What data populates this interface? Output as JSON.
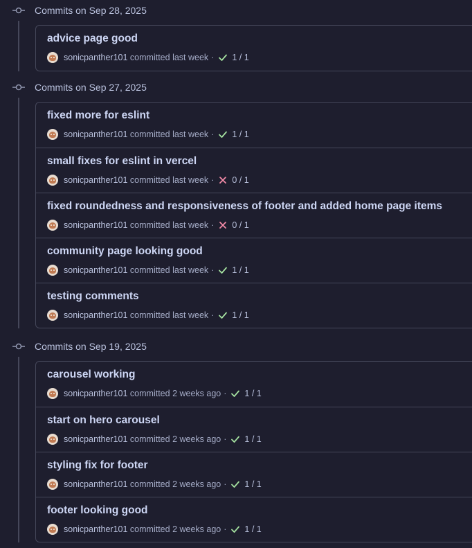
{
  "colors": {
    "background": "#1e1e2e",
    "border": "#45475a",
    "success": "#a6e3a1",
    "failure": "#f38ba8"
  },
  "groups": [
    {
      "header": "Commits on Sep 28, 2025",
      "commits": [
        {
          "title": "advice page good",
          "author": "sonicpanther101",
          "verb": "committed",
          "time": "last week",
          "status": "success",
          "checks": "1 / 1"
        }
      ]
    },
    {
      "header": "Commits on Sep 27, 2025",
      "commits": [
        {
          "title": "fixed more for eslint",
          "author": "sonicpanther101",
          "verb": "committed",
          "time": "last week",
          "status": "success",
          "checks": "1 / 1"
        },
        {
          "title": "small fixes for eslint in vercel",
          "author": "sonicpanther101",
          "verb": "committed",
          "time": "last week",
          "status": "failure",
          "checks": "0 / 1"
        },
        {
          "title": "fixed roundedness and responsiveness of footer and added home page items",
          "author": "sonicpanther101",
          "verb": "committed",
          "time": "last week",
          "status": "failure",
          "checks": "0 / 1"
        },
        {
          "title": "community page looking good",
          "author": "sonicpanther101",
          "verb": "committed",
          "time": "last week",
          "status": "success",
          "checks": "1 / 1"
        },
        {
          "title": "testing comments",
          "author": "sonicpanther101",
          "verb": "committed",
          "time": "last week",
          "status": "success",
          "checks": "1 / 1"
        }
      ]
    },
    {
      "header": "Commits on Sep 19, 2025",
      "commits": [
        {
          "title": "carousel working",
          "author": "sonicpanther101",
          "verb": "committed",
          "time": "2 weeks ago",
          "status": "success",
          "checks": "1 / 1"
        },
        {
          "title": "start on hero carousel",
          "author": "sonicpanther101",
          "verb": "committed",
          "time": "2 weeks ago",
          "status": "success",
          "checks": "1 / 1"
        },
        {
          "title": "styling fix for footer",
          "author": "sonicpanther101",
          "verb": "committed",
          "time": "2 weeks ago",
          "status": "success",
          "checks": "1 / 1"
        },
        {
          "title": "footer looking good",
          "author": "sonicpanther101",
          "verb": "committed",
          "time": "2 weeks ago",
          "status": "success",
          "checks": "1 / 1"
        }
      ]
    }
  ]
}
